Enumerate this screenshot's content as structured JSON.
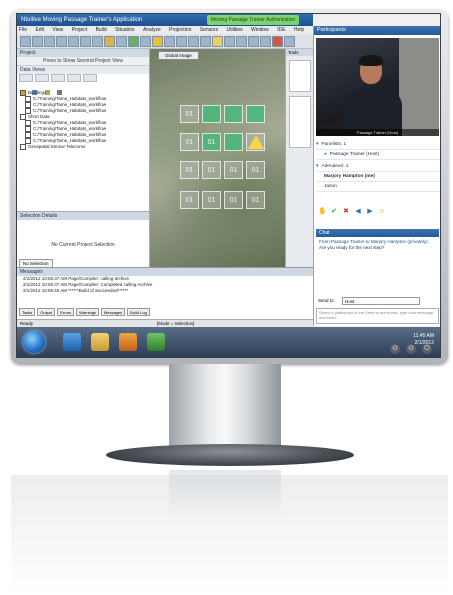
{
  "window": {
    "title": "Ntuitive Moving Passage Trainer's Application",
    "banner": "Moving Passage Trainer Authorization"
  },
  "menu": [
    "File",
    "Edit",
    "View",
    "Project",
    "Build",
    "Situation",
    "Analyze",
    "Projection",
    "Sensors",
    "Utilities",
    "Window",
    "IDE",
    "Help"
  ],
  "project_panel": {
    "header": "Project",
    "sub": "Press to Show Second Project View",
    "section": "Data Views",
    "tree": [
      "Buildings",
      "C:/Training/Tame_Habitats_workflow",
      "C:/Training/Tame_Habitats_workflow",
      "C:/Training/Tame_Habitats_workflow",
      "Short Data",
      "C:/Training/Tame_Habitats_workflow",
      "C:/Training/Tame_Habitats_workflow",
      "C:/Training/Tame_Habitats_workflow",
      "C:/Training/Tame_Habitats_workflow",
      "Geospatial Sensor Telecoms"
    ]
  },
  "selection": {
    "header": "Selection Details",
    "empty": "No Current Project Selection",
    "tab": "No Selection"
  },
  "map": {
    "tab": "Global Image",
    "cells": [
      "01",
      "01",
      "01",
      "01",
      "01",
      "01",
      "01",
      "01",
      "01",
      "01",
      "01",
      "01"
    ]
  },
  "log": {
    "header": "Messages",
    "rows": [
      "2/1/2012 10:55:37 AM  Page/Compiler: calling archive",
      "2/1/2012 10:55:37 AM  Page/Compiler: Completed calling Archive",
      "2/1/2012 10:55:40 AM  ******Build of Succeeded******"
    ],
    "tabs": [
      "Tasks",
      "Output",
      "Errors",
      "Warnings",
      "Messages",
      "Build Log"
    ]
  },
  "status": {
    "left": "Ready",
    "center": "[Mode = Selection]"
  },
  "participants": {
    "header": "Participants",
    "video_label": "Passage Trainer (Host)",
    "rows": [
      {
        "text": "Panelists: 1",
        "indent": false
      },
      {
        "text": "Passage Trainer (Host)",
        "indent": true
      },
      {
        "text": "Attendees: 1",
        "indent": false
      },
      {
        "text": "Marjory Hampton (me)",
        "indent": true
      },
      {
        "text": "Jason",
        "indent": true
      }
    ]
  },
  "chat": {
    "header": "Chat",
    "from": "From Passage Trainer to Marjory Hampton (privately):",
    "message": "Are you ready for the next step?",
    "send_to_label": "Send to:",
    "send_to_value": "Host",
    "input_placeholder": "Select a participant in the Send to menu first, type chat message, and send..."
  },
  "taskbar": {
    "time": "11:45 AM",
    "date": "2/1/2012"
  },
  "colors": {
    "titlebar": "#2f6fb5",
    "grid_green": "#40be78",
    "warning": "#f6d64a",
    "panel_header": "#275a95"
  }
}
